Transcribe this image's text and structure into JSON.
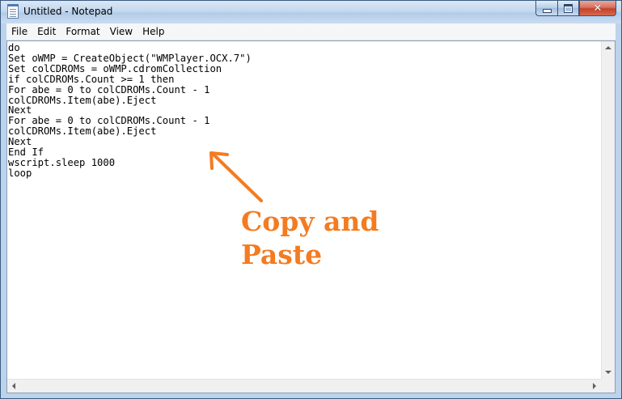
{
  "window": {
    "title": "Untitled - Notepad",
    "icon": "notepad-icon"
  },
  "menu": {
    "items": [
      "File",
      "Edit",
      "Format",
      "View",
      "Help"
    ]
  },
  "editor": {
    "lines": [
      "do",
      "Set oWMP = CreateObject(\"WMPlayer.OCX.7\")",
      "Set colCDROMs = oWMP.cdromCollection",
      "if colCDROMs.Count >= 1 then",
      "For abe = 0 to colCDROMs.Count - 1",
      "colCDROMs.Item(abe).Eject",
      "Next",
      "For abe = 0 to colCDROMs.Count - 1",
      "colCDROMs.Item(abe).Eject",
      "Next",
      "End If",
      "wscript.sleep 1000",
      "loop"
    ]
  },
  "annotation": {
    "text_line1": "Copy and",
    "text_line2": "Paste",
    "color": "#f47b20"
  }
}
